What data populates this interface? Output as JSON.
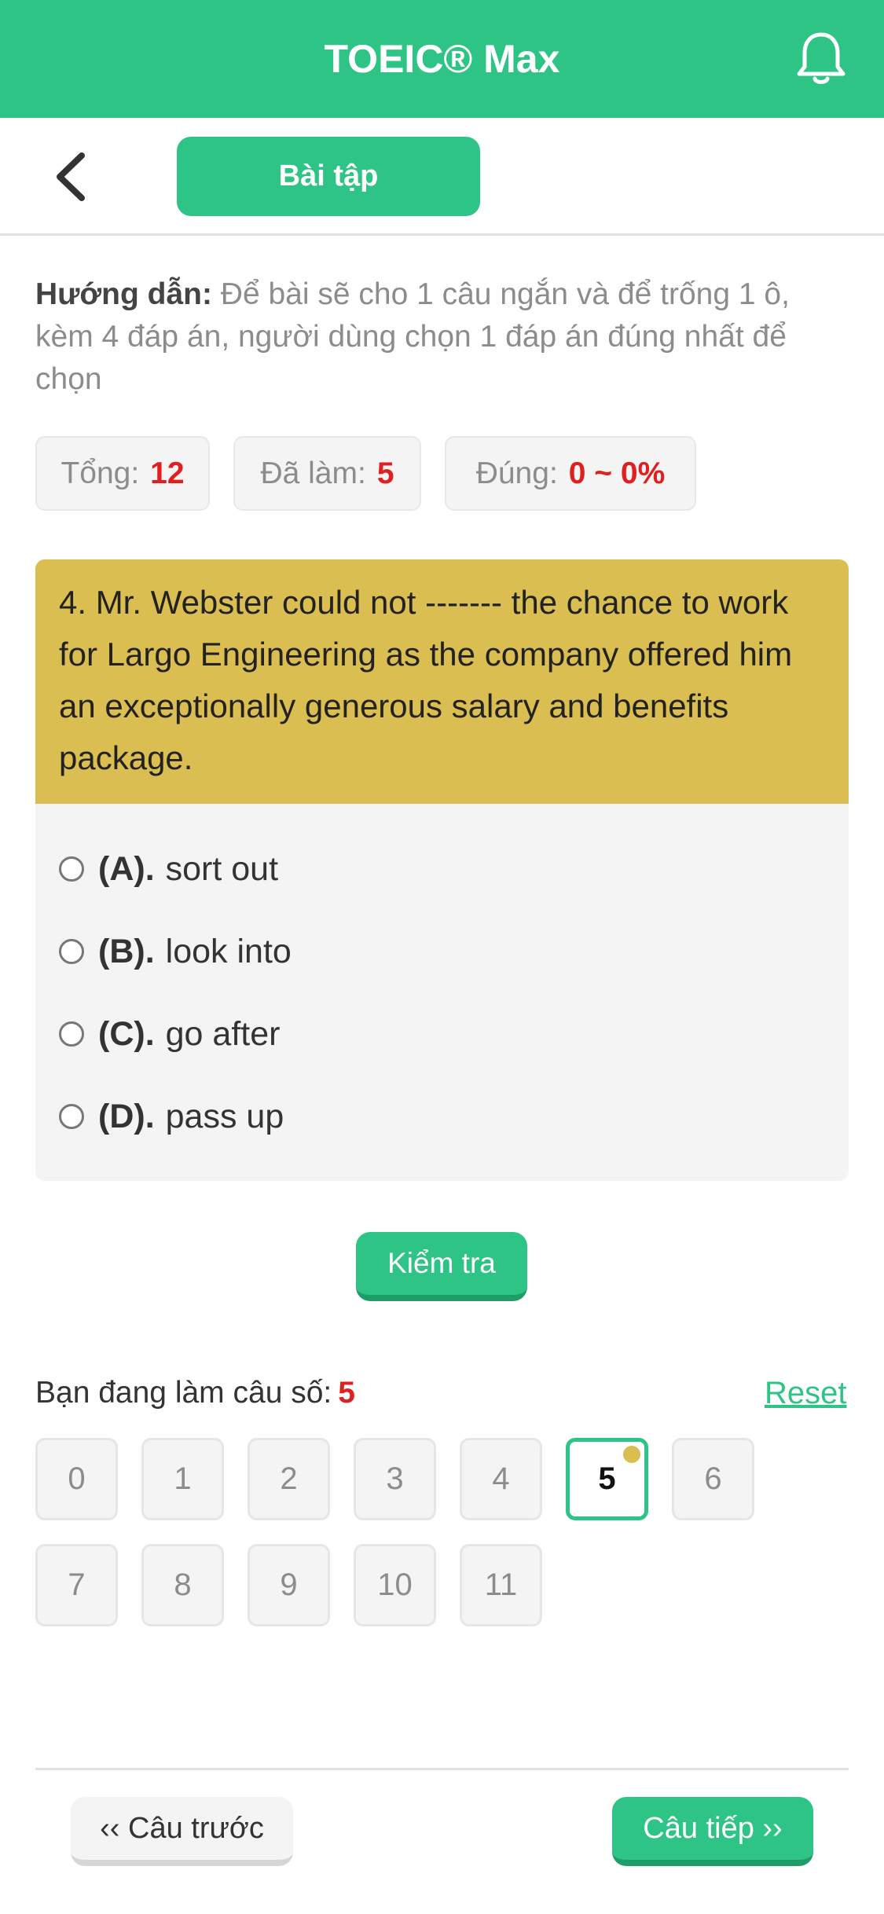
{
  "header": {
    "title": "TOEIC® Max",
    "notification_icon": "bell-icon"
  },
  "subbar": {
    "back_icon": "chevron-left-icon",
    "tab_label": "Bài tập"
  },
  "guide": {
    "label": "Hướng dẫn:",
    "text": "Để bài sẽ cho 1 câu ngắn và để trống 1 ô, kèm 4 đáp án, người dùng chọn 1 đáp án đúng nhất để chọn"
  },
  "stats": {
    "total_label": "Tổng:",
    "total_value": "12",
    "done_label": "Đã làm:",
    "done_value": "5",
    "correct_label": "Đúng:",
    "correct_value": "0 ~ 0%"
  },
  "question": {
    "text": "4. Mr. Webster could not ------- the chance to work for Largo Engineering as the company offered him an exceptionally generous salary and benefits package.",
    "options": [
      {
        "letter": "(A).",
        "text": "sort out",
        "selected": false
      },
      {
        "letter": "(B).",
        "text": "look into",
        "selected": false
      },
      {
        "letter": "(C).",
        "text": "go after",
        "selected": false
      },
      {
        "letter": "(D).",
        "text": "pass up",
        "selected": false
      }
    ]
  },
  "check_button": "Kiểm tra",
  "progress": {
    "label": "Bạn đang làm câu số:",
    "current": "5",
    "reset_label": "Reset",
    "questions": [
      "0",
      "1",
      "2",
      "3",
      "4",
      "5",
      "6",
      "7",
      "8",
      "9",
      "10",
      "11"
    ]
  },
  "footer": {
    "prev_label": "‹‹ Câu trước",
    "next_label": "Câu tiếp ››"
  },
  "colors": {
    "primary": "#2ec486",
    "question_bg": "#dbbe52",
    "highlight_value": "#e02020"
  }
}
